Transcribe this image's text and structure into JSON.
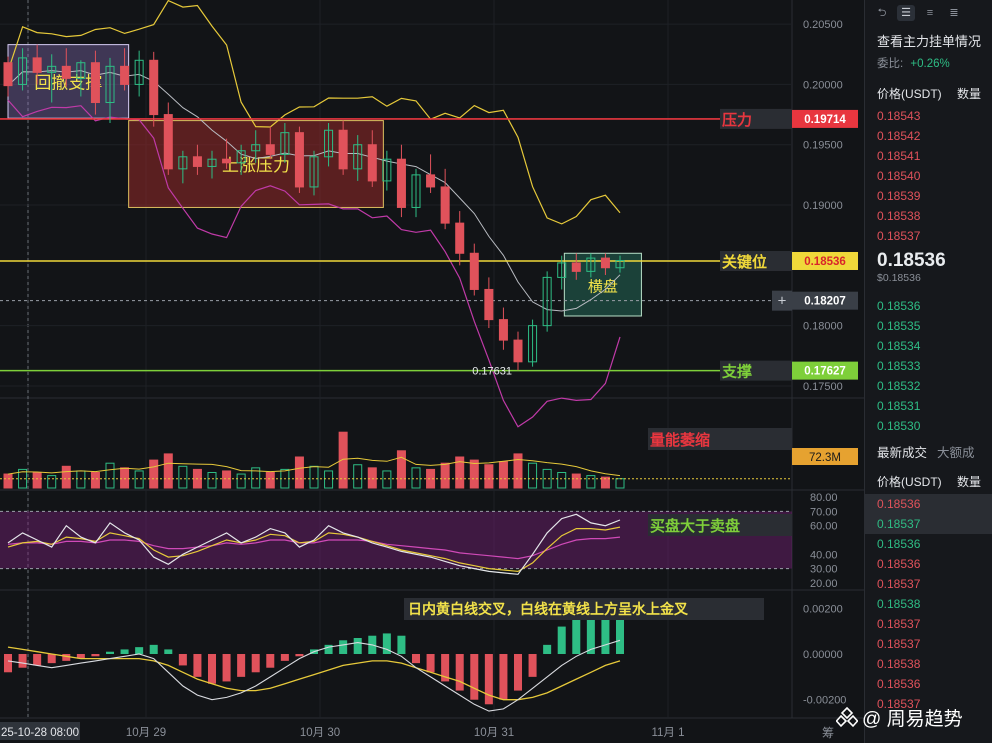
{
  "chart_data": {
    "type": "candlestick",
    "symbol_quote": "USDT",
    "x_ticks": [
      "25-10-28 08:00",
      "10月 29",
      "10月 30",
      "10月 31",
      "11月 1"
    ],
    "price_axis": {
      "ticks": [
        "0.20500",
        "0.20000",
        "0.19500",
        "0.19000",
        "0.18000",
        "0.17500"
      ],
      "ylim": [
        0.174,
        0.207
      ]
    },
    "price_levels": [
      {
        "name": "压力",
        "value": 0.19714,
        "label": "0.19714",
        "color": "#e8363f"
      },
      {
        "name": "关键位",
        "value": 0.18536,
        "label": "0.18536",
        "color": "#f0d83a"
      },
      {
        "name": "",
        "value": 0.18207,
        "label": "0.18207",
        "color": "#9aa0a8"
      },
      {
        "name": "支撑",
        "value": 0.17627,
        "label": "0.17627",
        "color": "#7ecf3a"
      }
    ],
    "low_marker": "0.17631",
    "zones": [
      {
        "label": "回撤支撑",
        "x0": 0.0,
        "x1": 3.6,
        "y_top": 0.2033,
        "y_bot": 0.1972,
        "fill": "rgba(150,120,200,0.35)",
        "stroke": "#d7cdf5"
      },
      {
        "label": "上涨压力",
        "x0": 3.6,
        "x1": 11.2,
        "y_top": 0.197,
        "y_bot": 0.1898,
        "fill": "rgba(150,40,40,0.55)",
        "stroke": "#e0c060"
      },
      {
        "label": "横盘",
        "x0": 16.6,
        "x1": 18.9,
        "y_top": 0.186,
        "y_bot": 0.1808,
        "fill": "rgba(40,120,100,0.45)",
        "stroke": "#b8e0c8"
      }
    ],
    "candles": [
      [
        0.2018,
        0.2023,
        0.199,
        0.1999
      ],
      [
        0.2,
        0.203,
        0.1995,
        0.2022
      ],
      [
        0.2022,
        0.2033,
        0.2,
        0.201
      ],
      [
        0.201,
        0.2025,
        0.1985,
        0.2015
      ],
      [
        0.2015,
        0.203,
        0.1998,
        0.2005
      ],
      [
        0.2005,
        0.202,
        0.199,
        0.2018
      ],
      [
        0.2018,
        0.2028,
        0.1975,
        0.1985
      ],
      [
        0.1985,
        0.2022,
        0.1968,
        0.2015
      ],
      [
        0.2015,
        0.203,
        0.1995,
        0.2
      ],
      [
        0.2,
        0.2028,
        0.199,
        0.202
      ],
      [
        0.202,
        0.2027,
        0.1965,
        0.1975
      ],
      [
        0.1975,
        0.1985,
        0.1925,
        0.193
      ],
      [
        0.193,
        0.1945,
        0.1918,
        0.194
      ],
      [
        0.194,
        0.195,
        0.1925,
        0.1932
      ],
      [
        0.1932,
        0.1945,
        0.1922,
        0.1938
      ],
      [
        0.1938,
        0.1955,
        0.193,
        0.1935
      ],
      [
        0.1935,
        0.195,
        0.1925,
        0.1945
      ],
      [
        0.1945,
        0.1962,
        0.1935,
        0.195
      ],
      [
        0.195,
        0.1965,
        0.1938,
        0.1942
      ],
      [
        0.1942,
        0.1968,
        0.1935,
        0.196
      ],
      [
        0.196,
        0.1965,
        0.191,
        0.1915
      ],
      [
        0.1915,
        0.1945,
        0.1908,
        0.194
      ],
      [
        0.194,
        0.1968,
        0.1932,
        0.1962
      ],
      [
        0.1962,
        0.197,
        0.1925,
        0.193
      ],
      [
        0.193,
        0.1958,
        0.192,
        0.195
      ],
      [
        0.195,
        0.1962,
        0.1915,
        0.192
      ],
      [
        0.192,
        0.1945,
        0.1912,
        0.1938
      ],
      [
        0.1938,
        0.195,
        0.189,
        0.1898
      ],
      [
        0.1898,
        0.193,
        0.189,
        0.1925
      ],
      [
        0.1925,
        0.1942,
        0.191,
        0.1915
      ],
      [
        0.1915,
        0.193,
        0.188,
        0.1885
      ],
      [
        0.1885,
        0.1895,
        0.185,
        0.186
      ],
      [
        0.186,
        0.1868,
        0.1825,
        0.183
      ],
      [
        0.183,
        0.184,
        0.1798,
        0.1805
      ],
      [
        0.1805,
        0.1815,
        0.178,
        0.1788
      ],
      [
        0.1788,
        0.1795,
        0.1763,
        0.177
      ],
      [
        0.177,
        0.1805,
        0.1766,
        0.18
      ],
      [
        0.18,
        0.1845,
        0.1795,
        0.184
      ],
      [
        0.184,
        0.1858,
        0.183,
        0.1852
      ],
      [
        0.1852,
        0.186,
        0.1838,
        0.1845
      ],
      [
        0.1845,
        0.186,
        0.184,
        0.1856
      ],
      [
        0.1856,
        0.186,
        0.1842,
        0.1848
      ],
      [
        0.1848,
        0.1858,
        0.1844,
        0.1854
      ]
    ],
    "volume_panel": {
      "label": "量能萎缩",
      "value_label": "72.3M",
      "values": [
        0.9,
        1.2,
        1.0,
        0.8,
        1.4,
        1.1,
        1.0,
        1.6,
        1.3,
        1.1,
        1.8,
        2.2,
        1.4,
        1.2,
        1.0,
        1.1,
        0.9,
        1.3,
        1.0,
        1.2,
        2.0,
        1.4,
        1.1,
        3.6,
        1.5,
        1.3,
        1.1,
        2.4,
        1.3,
        1.2,
        1.6,
        2.0,
        1.8,
        1.5,
        1.7,
        2.2,
        1.6,
        1.2,
        1.0,
        0.9,
        0.8,
        0.7,
        0.6
      ],
      "ylim": [
        0,
        4
      ]
    },
    "rsi_panel": {
      "label": "买盘大于卖盘",
      "ticks": [
        "80.00",
        "70.00",
        "60.00",
        "40.00",
        "30.00",
        "20.00"
      ],
      "ylim": [
        15,
        85
      ],
      "band": [
        30,
        70
      ],
      "white": [
        48,
        55,
        50,
        45,
        60,
        52,
        48,
        62,
        55,
        50,
        38,
        33,
        40,
        45,
        50,
        55,
        48,
        52,
        58,
        55,
        45,
        50,
        60,
        55,
        52,
        48,
        45,
        42,
        40,
        38,
        35,
        32,
        30,
        28,
        27,
        26,
        40,
        55,
        65,
        68,
        62,
        60,
        64
      ],
      "yellow": [
        45,
        48,
        49,
        47,
        52,
        51,
        49,
        55,
        53,
        51,
        43,
        38,
        39,
        42,
        46,
        50,
        48,
        50,
        54,
        53,
        48,
        49,
        55,
        54,
        52,
        49,
        46,
        43,
        41,
        39,
        37,
        34,
        32,
        30,
        29,
        28,
        34,
        44,
        53,
        58,
        58,
        57,
        59
      ],
      "magenta": [
        47,
        48,
        48,
        47,
        49,
        49,
        48,
        50,
        50,
        49,
        46,
        44,
        44,
        45,
        46,
        48,
        47,
        48,
        50,
        50,
        48,
        48,
        50,
        50,
        50,
        49,
        47,
        46,
        45,
        44,
        43,
        41,
        40,
        39,
        38,
        37,
        39,
        43,
        47,
        50,
        51,
        51,
        52
      ]
    },
    "macd_panel": {
      "label": "日内黄白线交叉，白线在黄线上方呈水上金叉",
      "ticks": [
        "0.00200",
        "0.00000",
        "-0.00200"
      ],
      "ylim": [
        -0.0028,
        0.0028
      ],
      "hist": [
        -0.0008,
        -0.0006,
        -0.0005,
        -0.0004,
        -0.0003,
        -0.0002,
        -0.0001,
        0.0001,
        0.0002,
        0.0003,
        0.0004,
        0.0002,
        -0.0005,
        -0.001,
        -0.0013,
        -0.0012,
        -0.001,
        -0.0008,
        -0.0006,
        -0.0003,
        -0.0001,
        0.0002,
        0.0004,
        0.0006,
        0.0007,
        0.0008,
        0.0009,
        0.0008,
        -0.0004,
        -0.0008,
        -0.0012,
        -0.0016,
        -0.002,
        -0.0022,
        -0.002,
        -0.0016,
        -0.001,
        0.0004,
        0.0012,
        0.0018,
        0.002,
        0.0019,
        0.0017
      ],
      "white": [
        -0.0003,
        -0.0004,
        -0.0005,
        -0.0006,
        -0.0005,
        -0.0004,
        -0.0003,
        -0.0002,
        -0.0001,
        0.0,
        -0.0002,
        -0.0008,
        -0.0014,
        -0.0018,
        -0.002,
        -0.0019,
        -0.0017,
        -0.0014,
        -0.001,
        -0.0006,
        -0.0002,
        0.0001,
        0.0003,
        0.0004,
        0.0005,
        0.0004,
        0.0002,
        -0.0001,
        -0.0006,
        -0.001,
        -0.0014,
        -0.0018,
        -0.0022,
        -0.0025,
        -0.0024,
        -0.002,
        -0.0015,
        -0.001,
        -0.0005,
        -0.0001,
        0.0002,
        0.0004,
        0.0006
      ],
      "yellow": [
        0.0003,
        0.0002,
        0.0001,
        0.0,
        -0.0001,
        -0.0002,
        -0.0002,
        -0.0002,
        -0.0002,
        -0.0002,
        -0.0003,
        -0.0005,
        -0.0008,
        -0.0011,
        -0.0013,
        -0.0015,
        -0.0016,
        -0.0016,
        -0.0015,
        -0.0013,
        -0.0011,
        -0.0009,
        -0.0007,
        -0.0005,
        -0.0004,
        -0.0003,
        -0.0003,
        -0.0004,
        -0.0006,
        -0.0008,
        -0.001,
        -0.0012,
        -0.0015,
        -0.0018,
        -0.002,
        -0.002,
        -0.0019,
        -0.0017,
        -0.0014,
        -0.0011,
        -0.0008,
        -0.0005,
        -0.0003
      ]
    }
  },
  "orderbook": {
    "title": "查看主力挂单情况",
    "ratio_label": "委比:",
    "ratio_value": "+0.26%",
    "col_price": "价格(USDT)",
    "col_qty": "数量",
    "asks": [
      "0.18543",
      "0.18542",
      "0.18541",
      "0.18540",
      "0.18539",
      "0.18538",
      "0.18537"
    ],
    "last_price": "0.18536",
    "last_price_sub": "$0.18536",
    "bids": [
      "0.18536",
      "0.18535",
      "0.18534",
      "0.18533",
      "0.18532",
      "0.18531",
      "0.18530"
    ],
    "tab_trades": "最新成交",
    "tab_big": "大额成",
    "trades_col_price": "价格(USDT)",
    "trades_col_qty": "数量",
    "trades": [
      {
        "p": "0.18536",
        "c": "red"
      },
      {
        "p": "0.18537",
        "c": "green"
      },
      {
        "p": "0.18536",
        "c": "green"
      },
      {
        "p": "0.18536",
        "c": "red"
      },
      {
        "p": "0.18537",
        "c": "red"
      },
      {
        "p": "0.18538",
        "c": "green"
      },
      {
        "p": "0.18537",
        "c": "red"
      },
      {
        "p": "0.18537",
        "c": "red"
      },
      {
        "p": "0.18538",
        "c": "red"
      },
      {
        "p": "0.18536",
        "c": "red"
      },
      {
        "p": "0.18537",
        "c": "red"
      }
    ]
  },
  "footer_label": "筹",
  "watermark": "@ 周易趋势"
}
